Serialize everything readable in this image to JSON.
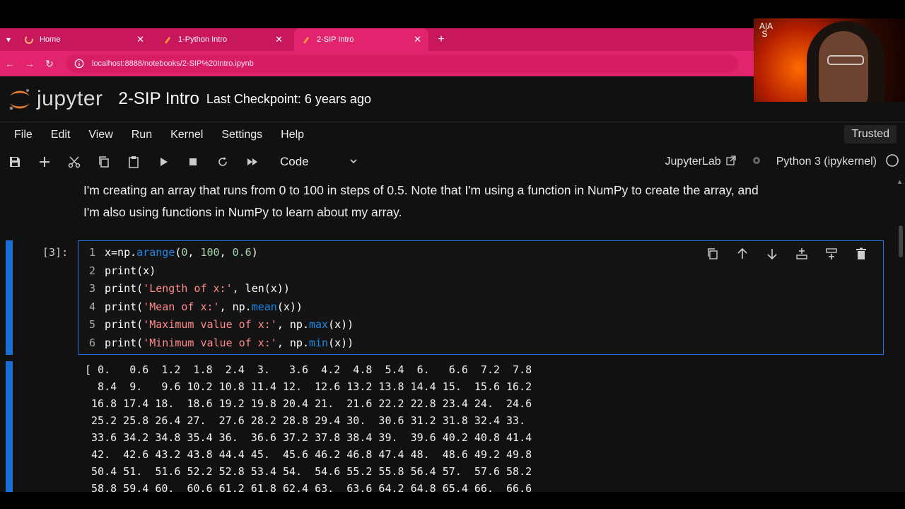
{
  "browser": {
    "tabs": [
      {
        "label": "Home",
        "active": false
      },
      {
        "label": "1-Python Intro",
        "active": false
      },
      {
        "label": "2-SIP Intro",
        "active": true
      }
    ],
    "url": "localhost:8888/notebooks/2-SIP%20Intro.ipynb"
  },
  "jupyter": {
    "logo_text": "jupyter",
    "notebook_title": "2-SIP Intro",
    "checkpoint": "Last Checkpoint: 6 years ago",
    "menu": [
      "File",
      "Edit",
      "View",
      "Run",
      "Kernel",
      "Settings",
      "Help"
    ],
    "trusted": "Trusted",
    "cell_type": "Code",
    "jupyterlab_label": "JupyterLab",
    "kernel": "Python 3 (ipykernel)"
  },
  "markdown": {
    "line1": "I'm creating an array that runs from 0 to 100 in steps of 0.5. Note that I'm using a function in NumPy to create the array, and",
    "line2": "I'm also using functions in NumPy to learn about my array."
  },
  "cell": {
    "prompt": "[3]:",
    "line_numbers": [
      "1",
      "2",
      "3",
      "4",
      "5",
      "6"
    ]
  },
  "output": {
    "lines": [
      "[ 0.   0.6  1.2  1.8  2.4  3.   3.6  4.2  4.8  5.4  6.   6.6  7.2  7.8",
      "  8.4  9.   9.6 10.2 10.8 11.4 12.  12.6 13.2 13.8 14.4 15.  15.6 16.2",
      " 16.8 17.4 18.  18.6 19.2 19.8 20.4 21.  21.6 22.2 22.8 23.4 24.  24.6",
      " 25.2 25.8 26.4 27.  27.6 28.2 28.8 29.4 30.  30.6 31.2 31.8 32.4 33.",
      " 33.6 34.2 34.8 35.4 36.  36.6 37.2 37.8 38.4 39.  39.6 40.2 40.8 41.4",
      " 42.  42.6 43.2 43.8 44.4 45.  45.6 46.2 46.8 47.4 48.  48.6 49.2 49.8",
      " 50.4 51.  51.6 52.2 52.8 53.4 54.  54.6 55.2 55.8 56.4 57.  57.6 58.2",
      " 58.8 59.4 60.  60.6 61.2 61.8 62.4 63.  63.6 64.2 64.8 65.4 66.  66.6"
    ]
  },
  "webcam": {
    "watermark": "A|A\n S"
  },
  "colors": {
    "tab_bar": "#c8175b",
    "address_bar": "#e2246e",
    "cell_accent": "#1a6fd3",
    "string": "#ff8a8a",
    "number": "#a5d6a7",
    "function": "#1e88e5"
  }
}
